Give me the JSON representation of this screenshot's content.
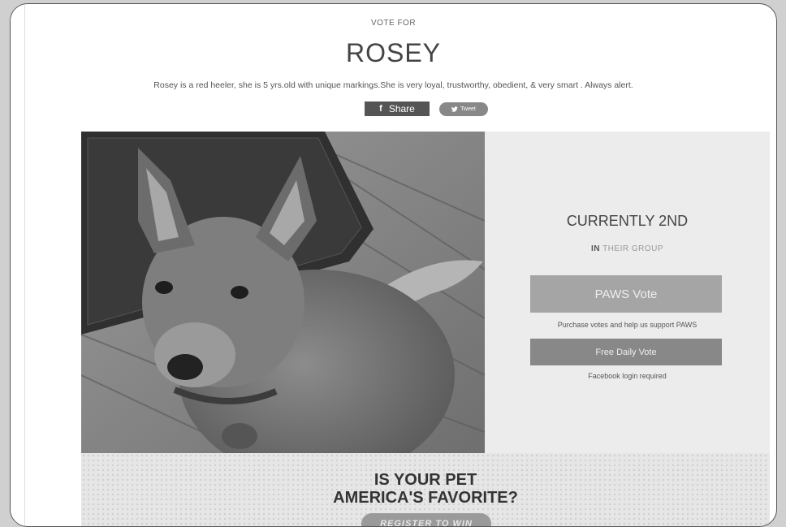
{
  "header": {
    "vote_for": "VOTE FOR",
    "pet_name": "ROSEY",
    "description": "Rosey is a red heeler, she is 5 yrs.old with unique markings.She is very loyal, trustworthy, obedient, & very smart . Always alert."
  },
  "share": {
    "facebook_icon": "f",
    "facebook_label": "Share",
    "tweet_label": "Tweet"
  },
  "panel": {
    "ranking": "CURRENTLY 2ND",
    "group_prefix": "IN",
    "group_suffix": "THEIR GROUP",
    "paws_vote_label": "PAWS Vote",
    "purchase_note": "Purchase votes and help us support PAWS",
    "free_vote_label": "Free Daily Vote",
    "login_note": "Facebook login required"
  },
  "promo": {
    "title_line1": "IS YOUR PET",
    "title_line2": "AMERICA'S FAVORITE?",
    "register_label": "REGISTER TO WIN"
  },
  "photo": {
    "alt_subject": "dog-photo"
  }
}
